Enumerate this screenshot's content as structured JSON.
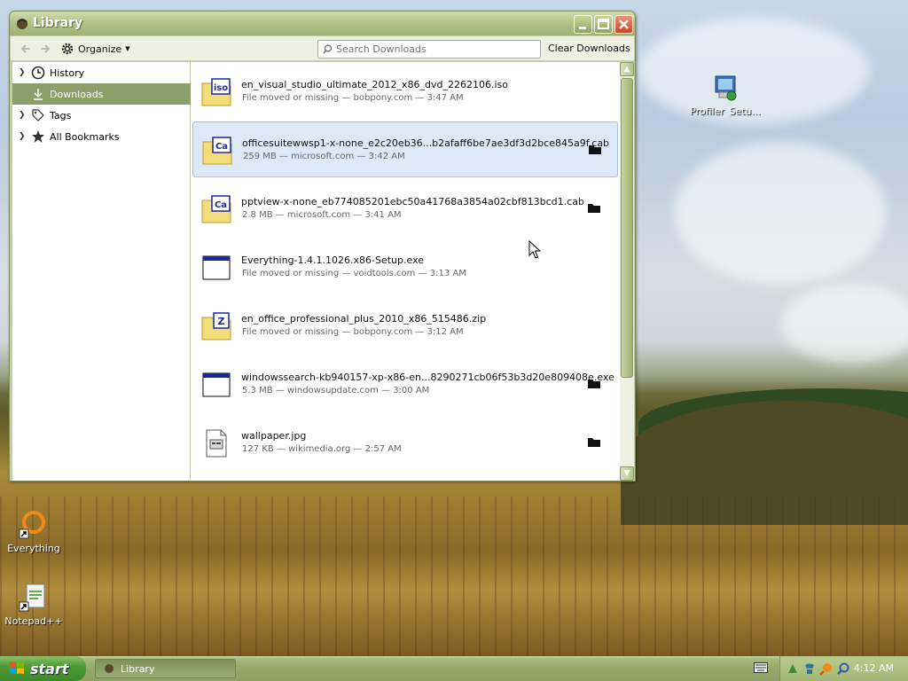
{
  "window": {
    "title": "Library",
    "minimize": "minimize",
    "maximize": "maximize",
    "close": "close"
  },
  "toolbar": {
    "back": "back",
    "forward": "forward",
    "organize_label": "Organize",
    "search_placeholder": "Search Downloads",
    "clear_label": "Clear Downloads"
  },
  "sidebar": {
    "items": [
      {
        "label": "History",
        "icon": "clock-icon",
        "expandable": true
      },
      {
        "label": "Downloads",
        "icon": "download-icon",
        "selected": true
      },
      {
        "label": "Tags",
        "icon": "tag-icon",
        "expandable": true
      },
      {
        "label": "All Bookmarks",
        "icon": "star-icon",
        "expandable": true
      }
    ]
  },
  "downloads": [
    {
      "name": "en_visual_studio_ultimate_2012_x86_dvd_2262106.iso",
      "meta": "File moved or missing — bobpony.com — 3:47 AM",
      "icon": "iso-file-icon",
      "icon_text": "iso",
      "folder": false
    },
    {
      "name": "officesuitewwsp1-x-none_e2c20eb36...b2afaff6be7ae3df3d2bce845a9f.cab",
      "meta": "259 MB — microsoft.com — 3:42 AM",
      "icon": "cab-file-icon",
      "icon_text": "Ca",
      "folder": true,
      "selected": true
    },
    {
      "name": "pptview-x-none_eb774085201ebc50a41768a3854a02cbf813bcd1.cab",
      "meta": "2.8 MB — microsoft.com — 3:41 AM",
      "icon": "cab-file-icon",
      "icon_text": "Ca",
      "folder": true
    },
    {
      "name": "Everything-1.4.1.1026.x86-Setup.exe",
      "meta": "File moved or missing — voidtools.com — 3:13 AM",
      "icon": "exe-file-icon",
      "icon_text": "",
      "folder": false
    },
    {
      "name": "en_office_professional_plus_2010_x86_515486.zip",
      "meta": "File moved or missing — bobpony.com — 3:12 AM",
      "icon": "zip-file-icon",
      "icon_text": "Z",
      "folder": false
    },
    {
      "name": "windowssearch-kb940157-xp-x86-en...8290271cb06f53b3d20e809408e.exe",
      "meta": "5.3 MB — windowsupdate.com — 3:00 AM",
      "icon": "exe-file-icon",
      "icon_text": "",
      "folder": true
    },
    {
      "name": "wallpaper.jpg",
      "meta": "127 KB — wikimedia.org — 2:57 AM",
      "icon": "image-file-icon",
      "icon_text": "",
      "folder": true
    }
  ],
  "desktop_icons": [
    {
      "label": "Profiler_Setu...",
      "icon": "installer-icon"
    },
    {
      "label": "Everything",
      "icon": "everything-icon"
    },
    {
      "label": "Notepad++",
      "icon": "notepadpp-icon"
    }
  ],
  "taskbar": {
    "start_label": "start",
    "task_label": "Library",
    "clock": "4:12 AM"
  },
  "colors": {
    "accent": "#8a9f6a",
    "selection": "#dde9f7",
    "start_green": "#4e9a36"
  }
}
